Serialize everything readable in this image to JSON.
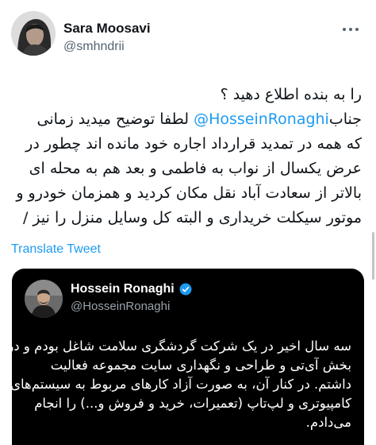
{
  "tweet": {
    "author_name": "Sara Moosavi",
    "author_handle": "@smhndrii",
    "lines": [
      {
        "text": "را به بنده اطلاع دهید ؟"
      },
      {
        "prefix": "جناب",
        "mention": "@HosseinRonaghi",
        "suffix": " لطفا توضیح میدید زمانی"
      },
      {
        "text": "که همه در تمدید قرارداد اجاره خود مانده اند چطور در"
      },
      {
        "text": "عرض یکسال از نواب به فاطمی و بعد هم به محله ای"
      },
      {
        "text": "بالاتر از سعادت آباد نقل مکان کردید و همزمان خودرو و"
      },
      {
        "text": "موتور سیکلت خریداری و البته کل وسایل منزل را نیز /"
      }
    ],
    "translate_label": "Translate Tweet"
  },
  "quoted": {
    "author_name": "Hossein Ronaghi",
    "author_handle": "@HosseinRonaghi",
    "lines": [
      "سه سال اخیر در یک شرکت گردشگری سلامت شاغل بودم و در",
      "بخش آی‌تی و طراحی و نگهداری سایت مجموعه فعالیت",
      "داشتم. در کنار آن، به صورت آزاد کارهای مربوط به سیستم‌های",
      "کامپیوتری و لپ‌تاپ (تعمیرات، خرید و فروش و...) را انجام",
      "می‌دادم."
    ]
  },
  "icons": {
    "more": "more-horizontal-icon",
    "verified": "verified-badge-icon"
  },
  "colors": {
    "accent": "#1d9bf0",
    "text": "#0f1419",
    "secondary": "#536471",
    "quote_bg": "#000000"
  }
}
